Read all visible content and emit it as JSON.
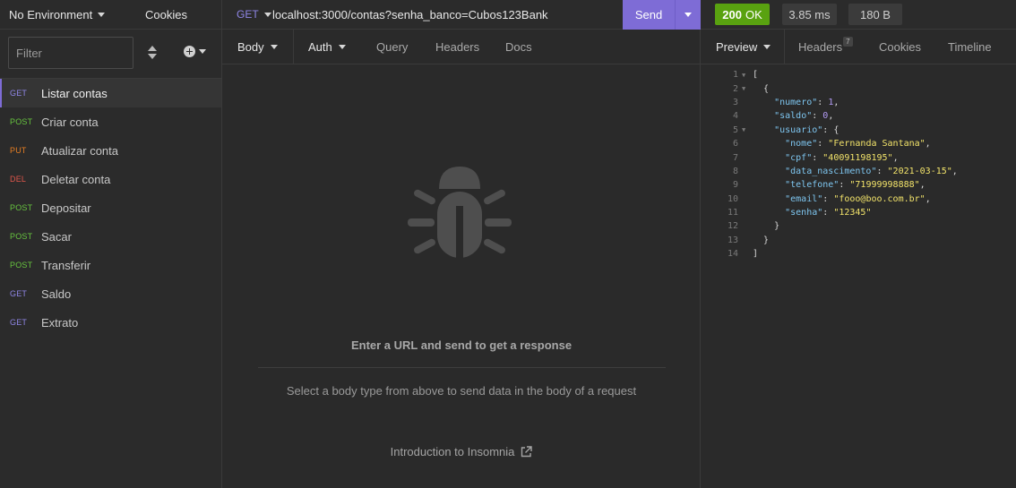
{
  "sidebar": {
    "environment": "No Environment",
    "cookies_label": "Cookies",
    "filter_placeholder": "Filter",
    "requests": [
      {
        "method": "GET",
        "name": "Listar contas",
        "active": true
      },
      {
        "method": "POST",
        "name": "Criar conta"
      },
      {
        "method": "PUT",
        "name": "Atualizar conta"
      },
      {
        "method": "DEL",
        "name": "Deletar conta"
      },
      {
        "method": "POST",
        "name": "Depositar"
      },
      {
        "method": "POST",
        "name": "Sacar"
      },
      {
        "method": "POST",
        "name": "Transferir"
      },
      {
        "method": "GET",
        "name": "Saldo"
      },
      {
        "method": "GET",
        "name": "Extrato"
      }
    ]
  },
  "request": {
    "method": "GET",
    "url": "localhost:3000/contas?senha_banco=Cubos123Bank",
    "send_label": "Send",
    "tabs": {
      "body": "Body",
      "auth": "Auth",
      "query": "Query",
      "headers": "Headers",
      "docs": "Docs"
    },
    "empty_title": "Enter a URL and send to get a response",
    "empty_subtitle": "Select a body type from above to send data in the body of a request",
    "intro_link": "Introduction to Insomnia"
  },
  "response": {
    "status_code": "200",
    "status_text": "OK",
    "time": "3.85 ms",
    "size": "180 B",
    "tabs": {
      "preview": "Preview",
      "headers": "Headers",
      "headers_count": "7",
      "cookies": "Cookies",
      "timeline": "Timeline"
    },
    "body_lines": [
      {
        "n": "1",
        "fold": true,
        "parts": [
          [
            "ct",
            "["
          ]
        ]
      },
      {
        "n": "2",
        "fold": true,
        "parts": [
          [
            "ct",
            "  {"
          ]
        ]
      },
      {
        "n": "3",
        "parts": [
          [
            "ct",
            "    "
          ],
          [
            "k",
            "\"numero\""
          ],
          [
            "ct",
            ": "
          ],
          [
            "n",
            "1"
          ],
          [
            "ct",
            ","
          ]
        ]
      },
      {
        "n": "4",
        "parts": [
          [
            "ct",
            "    "
          ],
          [
            "k",
            "\"saldo\""
          ],
          [
            "ct",
            ": "
          ],
          [
            "n",
            "0"
          ],
          [
            "ct",
            ","
          ]
        ]
      },
      {
        "n": "5",
        "fold": true,
        "parts": [
          [
            "ct",
            "    "
          ],
          [
            "k",
            "\"usuario\""
          ],
          [
            "ct",
            ": {"
          ]
        ]
      },
      {
        "n": "6",
        "parts": [
          [
            "ct",
            "      "
          ],
          [
            "k",
            "\"nome\""
          ],
          [
            "ct",
            ": "
          ],
          [
            "s",
            "\"Fernanda Santana\""
          ],
          [
            "ct",
            ","
          ]
        ]
      },
      {
        "n": "7",
        "parts": [
          [
            "ct",
            "      "
          ],
          [
            "k",
            "\"cpf\""
          ],
          [
            "ct",
            ": "
          ],
          [
            "s",
            "\"40091198195\""
          ],
          [
            "ct",
            ","
          ]
        ]
      },
      {
        "n": "8",
        "parts": [
          [
            "ct",
            "      "
          ],
          [
            "k",
            "\"data_nascimento\""
          ],
          [
            "ct",
            ": "
          ],
          [
            "s",
            "\"2021-03-15\""
          ],
          [
            "ct",
            ","
          ]
        ]
      },
      {
        "n": "9",
        "parts": [
          [
            "ct",
            "      "
          ],
          [
            "k",
            "\"telefone\""
          ],
          [
            "ct",
            ": "
          ],
          [
            "s",
            "\"71999998888\""
          ],
          [
            "ct",
            ","
          ]
        ]
      },
      {
        "n": "10",
        "parts": [
          [
            "ct",
            "      "
          ],
          [
            "k",
            "\"email\""
          ],
          [
            "ct",
            ": "
          ],
          [
            "s",
            "\"fooo@boo.com.br\""
          ],
          [
            "ct",
            ","
          ]
        ]
      },
      {
        "n": "11",
        "parts": [
          [
            "ct",
            "      "
          ],
          [
            "k",
            "\"senha\""
          ],
          [
            "ct",
            ": "
          ],
          [
            "s",
            "\"12345\""
          ]
        ]
      },
      {
        "n": "12",
        "parts": [
          [
            "ct",
            "    }"
          ]
        ]
      },
      {
        "n": "13",
        "parts": [
          [
            "ct",
            "  }"
          ]
        ]
      },
      {
        "n": "14",
        "parts": [
          [
            "ct",
            "]"
          ]
        ]
      }
    ]
  }
}
